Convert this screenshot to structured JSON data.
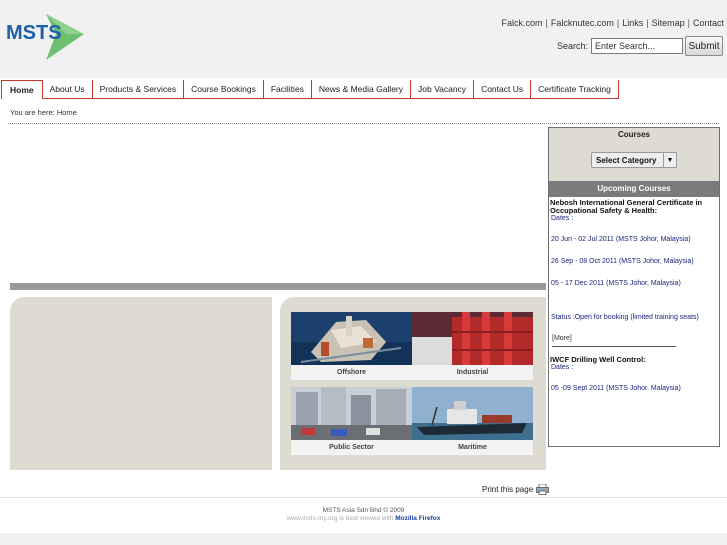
{
  "header": {
    "logo_text": "MSTS",
    "top_links": [
      "Falck.com",
      "Falcknutec.com",
      "Links",
      "Sitemap",
      "Contact"
    ],
    "search_label": "Search:",
    "search_placeholder": "Enter Search...",
    "submit_label": "Submit"
  },
  "nav": {
    "items": [
      "Home",
      "About Us",
      "Products & Services",
      "Course Bookings",
      "Facilities",
      "News & Media Gallery",
      "Job Vacancy",
      "Contact Us",
      "Certificate Tracking"
    ],
    "active": "Home"
  },
  "breadcrumb": "You are here: Home",
  "tiles": [
    {
      "caption": "Offshore",
      "icon": "offshore-image"
    },
    {
      "caption": "Industrial",
      "icon": "industrial-image"
    },
    {
      "caption": "Public Sector",
      "icon": "public-sector-image"
    },
    {
      "caption": "Maritime",
      "icon": "maritime-image"
    }
  ],
  "sidebar": {
    "courses_title": "Courses",
    "select_label": "Select Category",
    "upcoming_title": "Upcoming Courses",
    "course1": {
      "name": "Nebosh International General Certificate in Occupational Safety & Health:",
      "dates_label": "Dates :",
      "dates": [
        "20 Jun - 02 Jul 2011 (MSTS Johor, Malaysia)",
        "26 Sep - 08 Oct 2011 (MSTS Johor, Malaysia)",
        "05 - 17 Dec 2011 (MSTS Johor, Malaysia)"
      ],
      "status": "Status :Open for booking (limited training seats)",
      "more": "[More]"
    },
    "course2": {
      "name": "IWCF Drilling Well Control:",
      "dates_label": "Dates :",
      "dates": [
        "05 -09 Sept 2011 (MSTS Johor. Malaysia)"
      ]
    }
  },
  "print_label": "Print this page",
  "footer": {
    "copyright": "MSTS Asia Sdn Bhd © 2009",
    "best_viewed": "www.msts-my.org is best viewed with",
    "browser": "Mozilla Firefox"
  },
  "colors": {
    "nav_border": "#c0392b",
    "logo_blue": "#1e5fa8",
    "logo_green": "#5cb85c",
    "link_blue": "#1a237e"
  }
}
